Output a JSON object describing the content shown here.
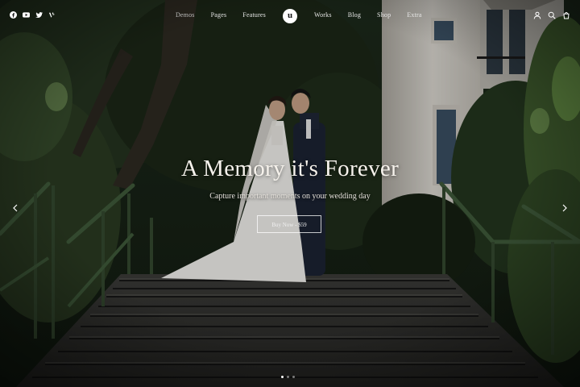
{
  "header": {
    "socials": [
      {
        "icon": "facebook-icon"
      },
      {
        "icon": "youtube-icon"
      },
      {
        "icon": "twitter-icon"
      },
      {
        "icon": "vine-icon"
      }
    ],
    "nav_left": [
      "Demos",
      "Pages",
      "Features"
    ],
    "logo_letter": "u",
    "nav_right": [
      "Works",
      "Blog",
      "Shop",
      "Extra"
    ],
    "right_icons": [
      "user-icon",
      "search-icon",
      "cart-icon"
    ]
  },
  "hero": {
    "title": "A Memory it's Forever",
    "subtitle": "Capture important moments on your wedding day",
    "cta_label": "Buy Now - $59"
  },
  "slider": {
    "slide_count": 3,
    "active_index": 0
  },
  "colors": {
    "foliage": "#1f2a1c",
    "wall": "#d8d4cc",
    "stairs": "#2a2a2a",
    "text": "#f6f2ec"
  }
}
